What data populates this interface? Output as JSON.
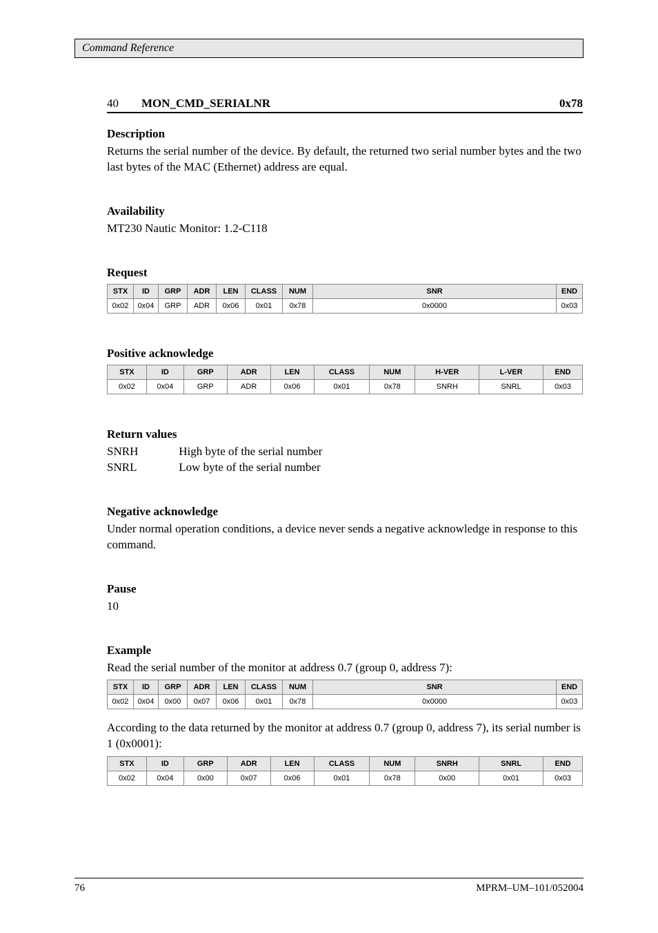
{
  "header": {
    "text": "Command Reference"
  },
  "command": {
    "number": "40",
    "name": "MON_CMD_SERIALNR",
    "security": "0x78"
  },
  "description": {
    "label": "Description",
    "text": "Returns the serial number of the device. By default, the returned two serial number bytes and the two last bytes of the MAC (Ethernet) address are equal."
  },
  "availability": {
    "label": "Availability",
    "text": "MT230 Nautic Monitor: 1.2-C118"
  },
  "request": {
    "label": "Request",
    "headers": [
      "STX",
      "ID",
      "GRP",
      "ADR",
      "LEN",
      "CLASS",
      "NUM",
      "SNR",
      "END"
    ],
    "values": [
      "0x02",
      "0x04",
      "GRP",
      "ADR",
      "0x06",
      "0x01",
      "0x78",
      "0x0000",
      "0x03"
    ]
  },
  "posack": {
    "label": "Positive acknowledge",
    "headers": [
      "STX",
      "ID",
      "GRP",
      "ADR",
      "LEN",
      "CLASS",
      "NUM",
      "H-VER",
      "L-VER",
      "END"
    ],
    "values": [
      "0x02",
      "0x04",
      "GRP",
      "ADR",
      "0x06",
      "0x01",
      "0x78",
      "SNRH",
      "SNRL",
      "0x03"
    ]
  },
  "return": {
    "label": "Return values",
    "rows": [
      {
        "name": "SNRH",
        "desc": "High byte of the serial number"
      },
      {
        "name": "SNRL",
        "desc": "Low byte of the serial number"
      }
    ]
  },
  "negack": {
    "label": "Negative acknowledge",
    "text": "Under normal operation conditions, a device never sends a negative acknowledge in response to this command."
  },
  "pause": {
    "label": "Pause",
    "value": "10"
  },
  "example": {
    "label": "Example",
    "text1": "Read the serial number of the monitor at address 0.7 (group 0, address 7):",
    "t1_headers": [
      "STX",
      "ID",
      "GRP",
      "ADR",
      "LEN",
      "CLASS",
      "NUM",
      "SNR",
      "END"
    ],
    "t1_values": [
      "0x02",
      "0x04",
      "0x00",
      "0x07",
      "0x06",
      "0x01",
      "0x78",
      "0x0000",
      "0x03"
    ],
    "text2": "According to the data returned by the monitor at address 0.7 (group 0, address 7), its serial number is 1 (0x0001):",
    "t2_headers": [
      "STX",
      "ID",
      "GRP",
      "ADR",
      "LEN",
      "CLASS",
      "NUM",
      "SNRH",
      "SNRL",
      "END"
    ],
    "t2_values": [
      "0x02",
      "0x04",
      "0x00",
      "0x07",
      "0x06",
      "0x01",
      "0x78",
      "0x00",
      "0x01",
      "0x03"
    ]
  },
  "footer": {
    "page": "76",
    "doc": "MPRM–UM–101/052004"
  }
}
